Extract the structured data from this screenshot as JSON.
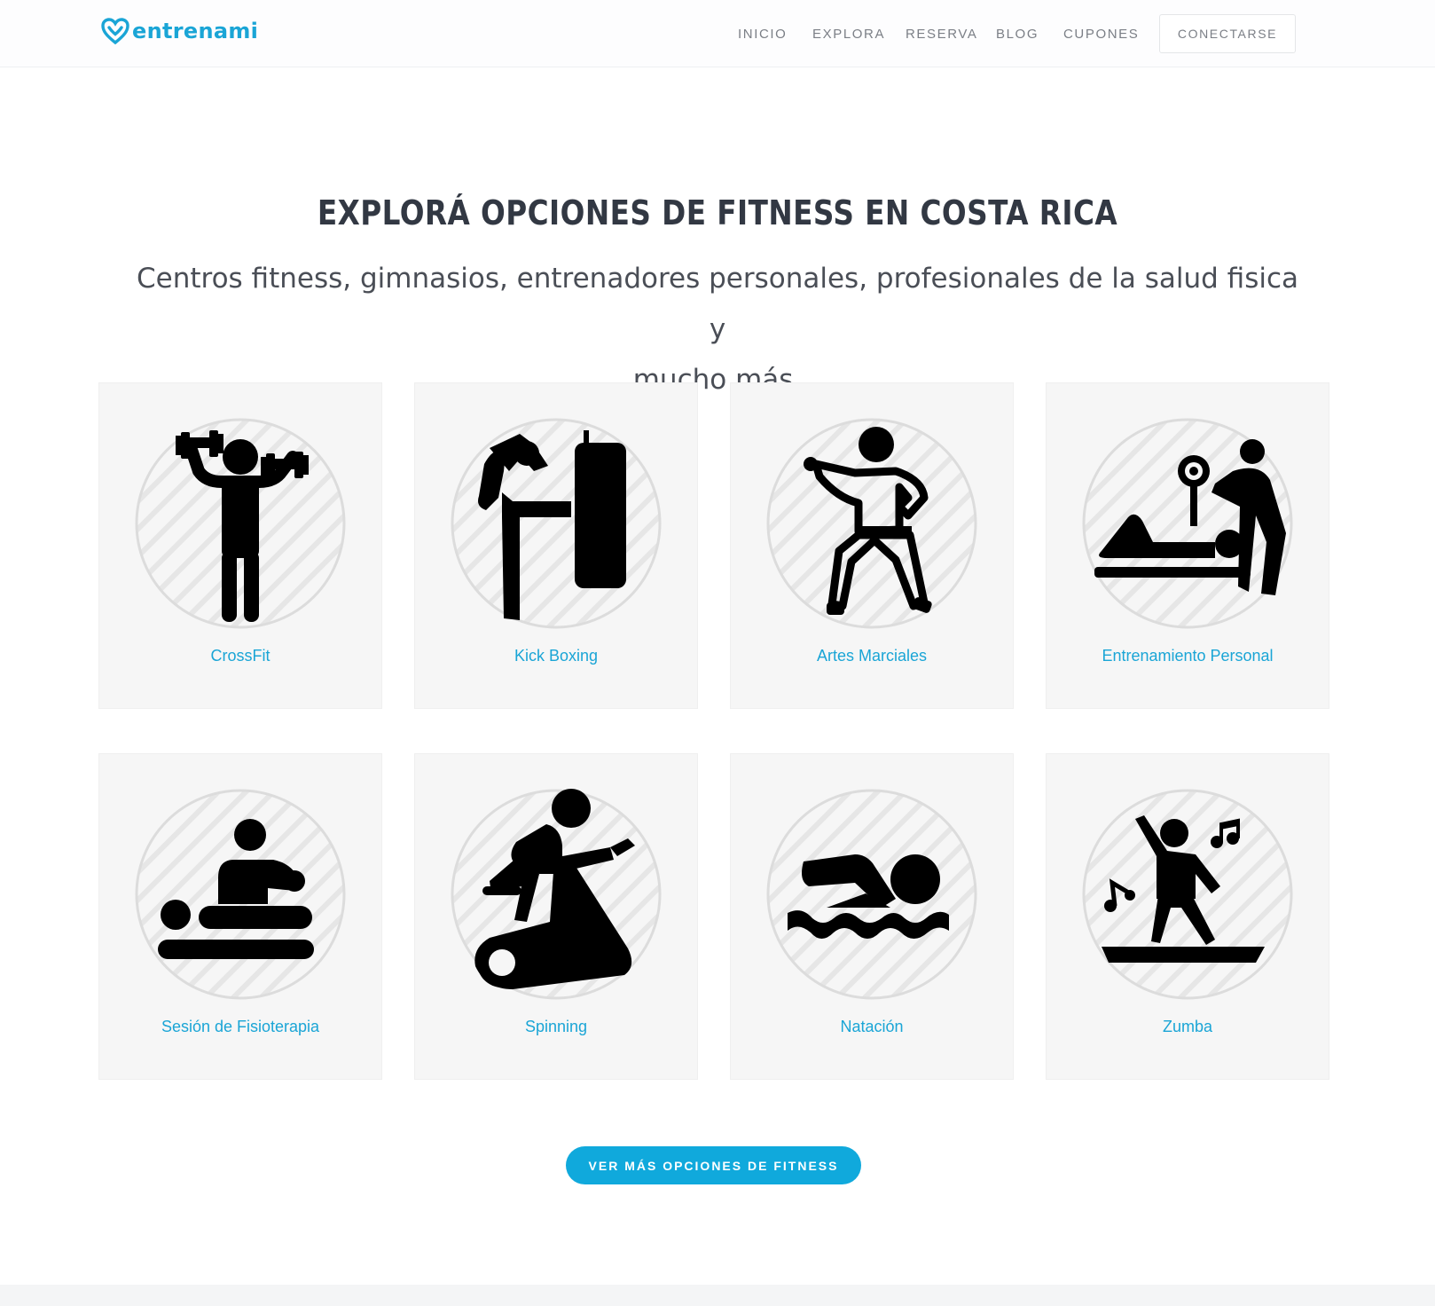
{
  "brand": {
    "name": "entrenami",
    "logo_icon": "heart-logo-icon",
    "color": "#1aa5d6"
  },
  "nav": {
    "items": [
      "INICIO",
      "EXPLORA",
      "RESERVA",
      "BLOG",
      "CUPONES"
    ],
    "connect_label": "CONECTARSE"
  },
  "main": {
    "title": "EXPLORÁ OPCIONES DE FITNESS EN COSTA RICA",
    "subtitle_line1": "Centros fitness, gimnasios, entrenadores personales, profesionales de la salud fisica y",
    "subtitle_line2": "mucho más.",
    "cards": [
      {
        "label": "CrossFit",
        "icon": "weightlifter-icon"
      },
      {
        "label": "Kick Boxing",
        "icon": "kickboxing-icon"
      },
      {
        "label": "Artes Marciales",
        "icon": "karate-icon"
      },
      {
        "label": "Entrenamiento Personal",
        "icon": "personal-trainer-icon"
      },
      {
        "label": "Sesión de Fisioterapia",
        "icon": "physiotherapy-icon"
      },
      {
        "label": "Spinning",
        "icon": "spinning-bike-icon"
      },
      {
        "label": "Natación",
        "icon": "swimmer-icon"
      },
      {
        "label": "Zumba",
        "icon": "dancer-icon"
      }
    ],
    "cta_label": "VER MÁS OPCIONES DE FITNESS"
  },
  "colors": {
    "accent": "#1aa5d6",
    "button": "#10a9dc",
    "card_bg": "#f6f6f6",
    "title": "#323843"
  }
}
